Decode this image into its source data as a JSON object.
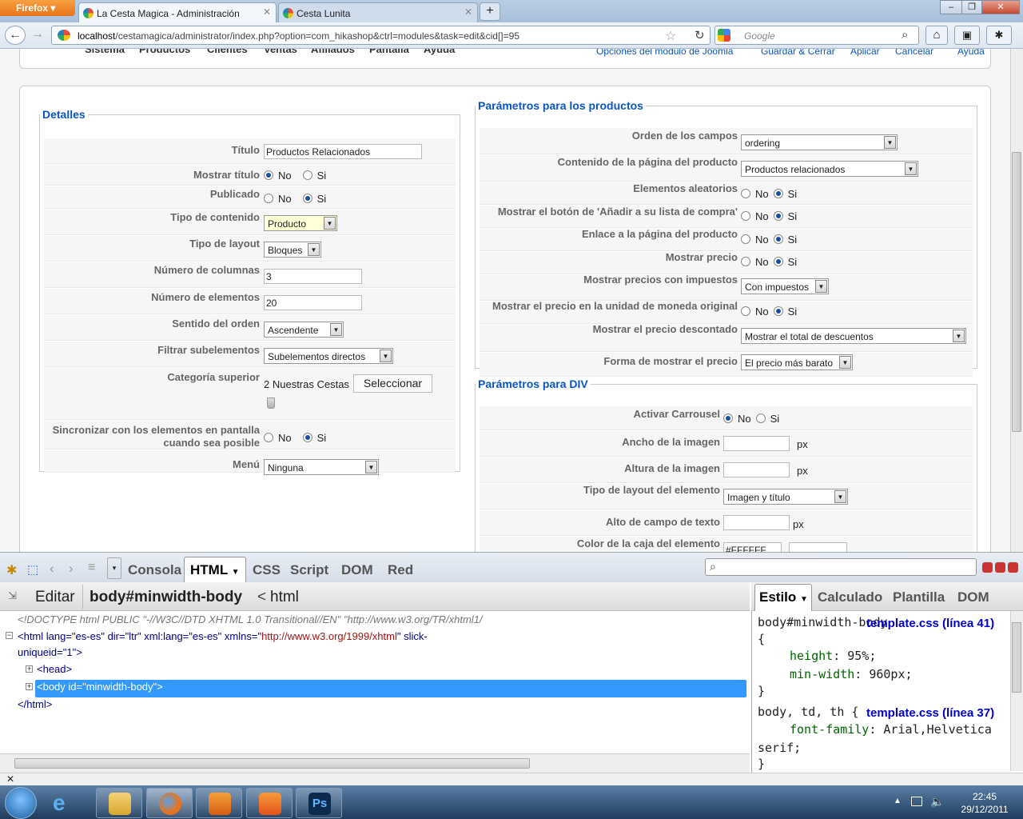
{
  "browser": {
    "ff_label": "Firefox",
    "tabs": [
      {
        "label": "La Cesta Magica - Administración"
      },
      {
        "label": "Cesta Lunita"
      }
    ],
    "new_tab": "+",
    "url_host": "localhost",
    "url_path": "/cestamagica/administrator/index.php?option=com_hikashop&ctrl=modules&task=edit&cid[]=95",
    "search_placeholder": "Google",
    "win_min": "–",
    "win_max": "❐",
    "win_close": "✕"
  },
  "admin_menu": [
    "Sistema",
    "Productos",
    "Clientes",
    "Ventas",
    "Afiliados",
    "Pantalla",
    "Ayuda"
  ],
  "toolbar": {
    "joomla_opts": "Opciones del módulo de Joomla",
    "save_close": "Guardar & Cerrar",
    "apply": "Aplicar",
    "cancel": "Cancelar",
    "help": "Ayuda"
  },
  "details": {
    "legend": "Detalles",
    "titulo_label": "Título",
    "titulo_value": "Productos Relacionados",
    "mostrar_titulo_label": "Mostrar título",
    "publicado_label": "Publicado",
    "tipo_contenido_label": "Tipo de contenido",
    "tipo_contenido_value": "Producto",
    "tipo_layout_label": "Tipo de layout",
    "tipo_layout_value": "Bloques",
    "num_columnas_label": "Número de columnas",
    "num_columnas_value": "3",
    "num_elementos_label": "Número de elementos",
    "num_elementos_value": "20",
    "sentido_label": "Sentido del orden",
    "sentido_value": "Ascendente",
    "filtrar_label": "Filtrar subelementos",
    "filtrar_value": "Subelementos directos",
    "categoria_label": "Categoría superior",
    "categoria_value": "2 Nuestras Cestas",
    "seleccionar": "Seleccionar",
    "sincronizar_label": "Sincronizar con los elementos en pantalla cuando sea posible",
    "menu_label": "Menú",
    "menu_value": "Ninguna",
    "no": "No",
    "si": "Si"
  },
  "products": {
    "legend": "Parámetros para los productos",
    "orden_label": "Orden de los campos",
    "orden_value": "ordering",
    "contenido_label": "Contenido de la página del producto",
    "contenido_value": "Productos relacionados",
    "aleatorios_label": "Elementos aleatorios",
    "boton_label": "Mostrar el botón de 'Añadir a su lista de compra'",
    "enlace_label": "Enlace a la página del producto",
    "precio_label": "Mostrar precio",
    "impuestos_label": "Mostrar precios con impuestos",
    "impuestos_value": "Con impuestos",
    "moneda_label": "Mostrar el precio en la unidad de moneda original",
    "descontado_label": "Mostrar el precio descontado",
    "descontado_value": "Mostrar el total de descuentos",
    "forma_label": "Forma de mostrar el precio",
    "forma_value": "El precio más barato"
  },
  "div": {
    "legend": "Parámetros para DIV",
    "carrousel_label": "Activar Carrousel",
    "ancho_label": "Ancho de la imagen",
    "altura_label": "Altura de la imagen",
    "tipo_elemento_label": "Tipo de layout del elemento",
    "tipo_elemento_value": "Imagen y título",
    "alto_campo_label": "Alto de campo de texto",
    "color_label": "Color de la caja del elemento",
    "color_value": "#FFFFFF",
    "px": "px"
  },
  "firebug": {
    "tabs": [
      "Consola",
      "HTML",
      "CSS",
      "Script",
      "DOM",
      "Red"
    ],
    "editar": "Editar",
    "crumb_body": "body#minwidth-body",
    "crumb_sep": "<",
    "crumb_html": "html",
    "doctype": "<!DOCTYPE html PUBLIC \"-//W3C//DTD XHTML 1.0 Transitional//EN\" \"http://www.w3.org/TR/xhtml1/",
    "html_open_a": "<html lang=\"es-es\" dir=\"ltr\" xml:lang=\"es-es\" xmlns=\"",
    "html_ns": "http://www.w3.org/1999/xhtml",
    "html_open_b": "\" slick-",
    "html_open_c": "uniqueid=\"1\">",
    "head": "<head>",
    "body": "<body id=\"minwidth-body\">",
    "html_close": "</html>",
    "side_tabs": [
      "Estilo",
      "Calculado",
      "Plantilla",
      "DOM"
    ],
    "rule1_sel": "body#minwidth-body",
    "rule1_link": "template.css (línea 41)",
    "brace_open": "{",
    "brace_close": "}",
    "p_height": "height",
    "v_height": "95%;",
    "p_minw": "min-width",
    "v_minw": "960px;",
    "rule2_sel": "body, td, th {",
    "rule2_link": "template.css (línea 37)",
    "p_font": "font-family",
    "v_font": "Arial,Helvetica",
    "v_font2": "serif;"
  },
  "status": {
    "close": "✕"
  },
  "clock": {
    "time": "22:45",
    "date": "29/12/2011"
  }
}
